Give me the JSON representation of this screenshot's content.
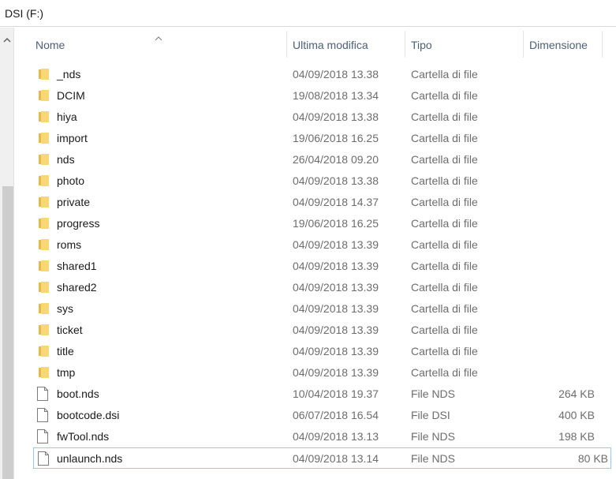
{
  "address_bar": {
    "path": "DSI (F:)"
  },
  "columns": {
    "name": "Nome",
    "modified": "Ultima modifica",
    "type": "Tipo",
    "size": "Dimensione"
  },
  "items": [
    {
      "name": "_nds",
      "modified": "04/09/2018 13.38",
      "type": "Cartella di file",
      "size": "",
      "icon": "folder-icon"
    },
    {
      "name": "DCIM",
      "modified": "19/08/2018 13.34",
      "type": "Cartella di file",
      "size": "",
      "icon": "folder-icon"
    },
    {
      "name": "hiya",
      "modified": "04/09/2018 13.38",
      "type": "Cartella di file",
      "size": "",
      "icon": "folder-icon"
    },
    {
      "name": "import",
      "modified": "19/06/2018 16.25",
      "type": "Cartella di file",
      "size": "",
      "icon": "folder-icon"
    },
    {
      "name": "nds",
      "modified": "26/04/2018 09.20",
      "type": "Cartella di file",
      "size": "",
      "icon": "folder-icon"
    },
    {
      "name": "photo",
      "modified": "04/09/2018 13.38",
      "type": "Cartella di file",
      "size": "",
      "icon": "folder-icon"
    },
    {
      "name": "private",
      "modified": "04/09/2018 14.37",
      "type": "Cartella di file",
      "size": "",
      "icon": "folder-icon"
    },
    {
      "name": "progress",
      "modified": "19/06/2018 16.25",
      "type": "Cartella di file",
      "size": "",
      "icon": "folder-icon"
    },
    {
      "name": "roms",
      "modified": "04/09/2018 13.39",
      "type": "Cartella di file",
      "size": "",
      "icon": "folder-icon"
    },
    {
      "name": "shared1",
      "modified": "04/09/2018 13.39",
      "type": "Cartella di file",
      "size": "",
      "icon": "folder-icon"
    },
    {
      "name": "shared2",
      "modified": "04/09/2018 13.39",
      "type": "Cartella di file",
      "size": "",
      "icon": "folder-icon"
    },
    {
      "name": "sys",
      "modified": "04/09/2018 13.39",
      "type": "Cartella di file",
      "size": "",
      "icon": "folder-icon"
    },
    {
      "name": "ticket",
      "modified": "04/09/2018 13.39",
      "type": "Cartella di file",
      "size": "",
      "icon": "folder-icon"
    },
    {
      "name": "title",
      "modified": "04/09/2018 13.39",
      "type": "Cartella di file",
      "size": "",
      "icon": "folder-icon"
    },
    {
      "name": "tmp",
      "modified": "04/09/2018 13.39",
      "type": "Cartella di file",
      "size": "",
      "icon": "folder-icon"
    },
    {
      "name": "boot.nds",
      "modified": "10/04/2018 19.37",
      "type": "File NDS",
      "size": "264 KB",
      "icon": "file-icon"
    },
    {
      "name": "bootcode.dsi",
      "modified": "06/07/2018 16.54",
      "type": "File DSI",
      "size": "400 KB",
      "icon": "file-icon"
    },
    {
      "name": "fwTool.nds",
      "modified": "04/09/2018 13.13",
      "type": "File NDS",
      "size": "198 KB",
      "icon": "file-icon"
    },
    {
      "name": "unlaunch.nds",
      "modified": "04/09/2018 13.14",
      "type": "File NDS",
      "size": "80 KB",
      "icon": "file-icon",
      "selected": true
    }
  ],
  "colors": {
    "folder": "#f8d775",
    "folder_dark": "#e8b84a",
    "header_text": "#4c607a",
    "selection_border": "#99c9ef",
    "muted_text": "#6d6d6d"
  }
}
